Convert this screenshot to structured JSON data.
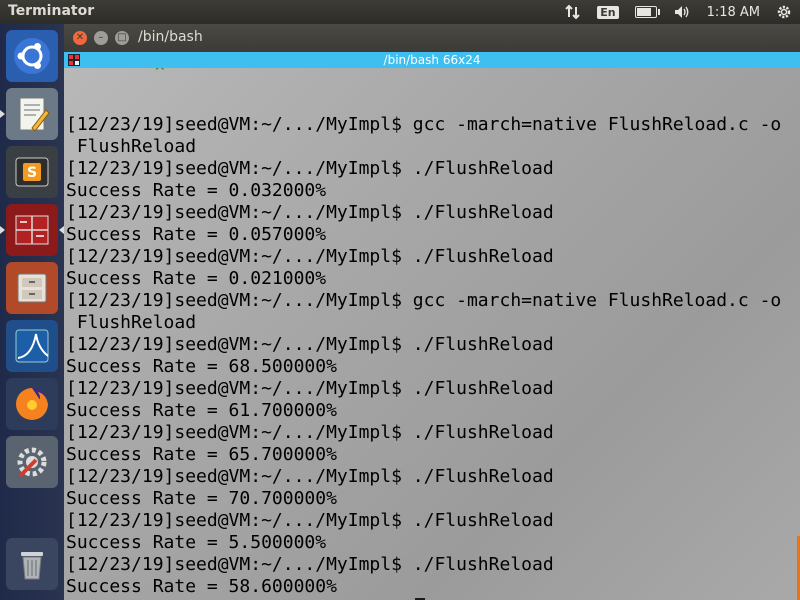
{
  "top_panel": {
    "app_title": "Terminator",
    "tray": {
      "network_icon": "network-updown-icon",
      "keyboard_layout": "En",
      "battery_icon": "battery-icon",
      "volume_icon": "volume-icon",
      "clock": "1:18 AM",
      "settings_icon": "gear-icon"
    }
  },
  "launcher": {
    "items": [
      {
        "name": "ubuntu-logo-icon"
      },
      {
        "name": "text-editor-icon"
      },
      {
        "name": "sublime-text-icon"
      },
      {
        "name": "terminator-icon"
      },
      {
        "name": "file-manager-icon"
      },
      {
        "name": "wireshark-icon"
      },
      {
        "name": "firefox-icon"
      },
      {
        "name": "system-settings-icon"
      },
      {
        "name": "trash-icon"
      }
    ]
  },
  "window": {
    "title": "/bin/bash",
    "terminal_header": "/bin/bash 66x24"
  },
  "terminal": {
    "lines": [
      "[12/23/19]seed@VM:~/.../MyImpl$ gcc -march=native FlushReload.c -o",
      " FlushReload",
      "[12/23/19]seed@VM:~/.../MyImpl$ ./FlushReload",
      "Success Rate = 0.032000%",
      "[12/23/19]seed@VM:~/.../MyImpl$ ./FlushReload",
      "Success Rate = 0.057000%",
      "[12/23/19]seed@VM:~/.../MyImpl$ ./FlushReload",
      "Success Rate = 0.021000%",
      "[12/23/19]seed@VM:~/.../MyImpl$ gcc -march=native FlushReload.c -o",
      " FlushReload",
      "[12/23/19]seed@VM:~/.../MyImpl$ ./FlushReload",
      "Success Rate = 68.500000%",
      "[12/23/19]seed@VM:~/.../MyImpl$ ./FlushReload",
      "Success Rate = 61.700000%",
      "[12/23/19]seed@VM:~/.../MyImpl$ ./FlushReload",
      "Success Rate = 65.700000%",
      "[12/23/19]seed@VM:~/.../MyImpl$ ./FlushReload",
      "Success Rate = 70.700000%",
      "[12/23/19]seed@VM:~/.../MyImpl$ ./FlushReload",
      "Success Rate = 5.500000%",
      "[12/23/19]seed@VM:~/.../MyImpl$ ./FlushReload",
      "Success Rate = 58.600000%"
    ],
    "prompt": "[12/23/19]seed@VM:~/.../MyImpl$ "
  },
  "colors": {
    "launcher_bg": "#1f2a4a",
    "header_accent": "#3fbff0",
    "close_button": "#f0683b"
  }
}
